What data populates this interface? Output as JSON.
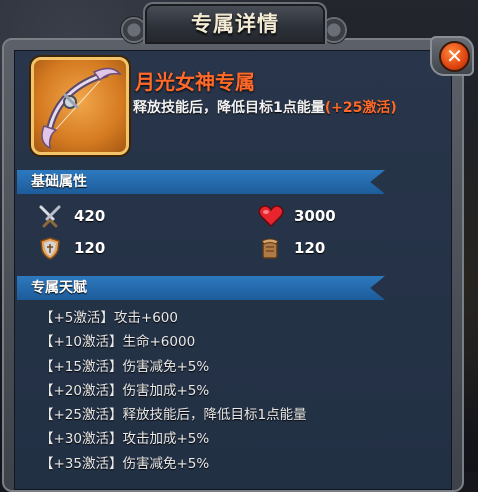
{
  "window": {
    "title": "专属详情"
  },
  "item": {
    "name": "月光女神专属",
    "description": "释放技能后，降低目标1点能量",
    "bonus": "(+25激活)"
  },
  "sections": {
    "base_attributes": "基础属性",
    "exclusive_talents": "专属天赋"
  },
  "stats": {
    "attack": "420",
    "hp": "3000",
    "defense": "120",
    "resistance": "120"
  },
  "talents": [
    {
      "level": "+5激活",
      "effect": "攻击+600"
    },
    {
      "level": "+10激活",
      "effect": "生命+6000"
    },
    {
      "level": "+15激活",
      "effect": "伤害减免+5%"
    },
    {
      "level": "+20激活",
      "effect": "伤害加成+5%"
    },
    {
      "level": "+25激活",
      "effect": "释放技能后，降低目标1点能量"
    },
    {
      "level": "+30激活",
      "effect": "攻击加成+5%"
    },
    {
      "level": "+35激活",
      "effect": "伤害减免+5%"
    }
  ],
  "icons": {
    "close": "close-icon",
    "attack": "crossed-swords-icon",
    "hp": "heart-icon",
    "defense": "shield-icon",
    "resistance": "scroll-icon",
    "item": "bow-icon"
  },
  "colors": {
    "item_name": "#ff6a2a",
    "section_header": "#2d79bf",
    "panel_bg": "#243042"
  }
}
